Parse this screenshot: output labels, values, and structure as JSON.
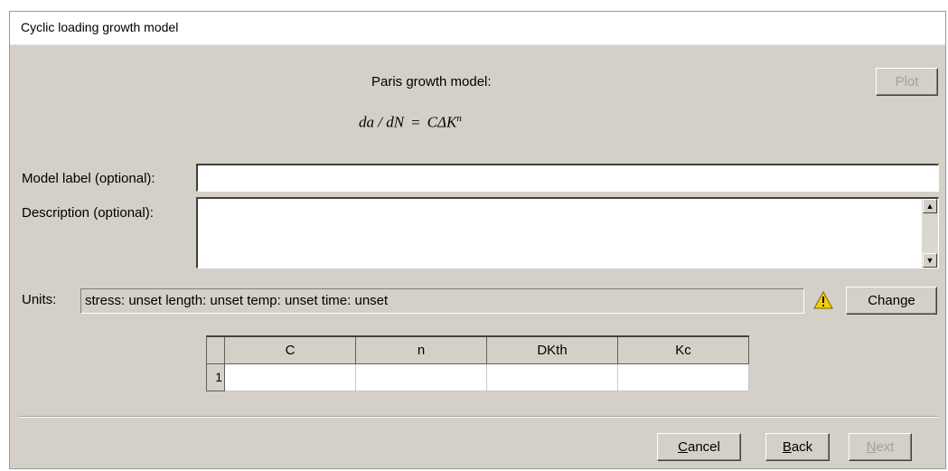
{
  "window": {
    "title": "Cyclic loading growth model"
  },
  "header": {
    "model_caption": "Paris growth model:",
    "formula": {
      "lhs": "da / dN",
      "eq": "=",
      "rhs": "CΔK",
      "exponent": "n"
    },
    "plot_button": "Plot"
  },
  "form": {
    "model_label": {
      "label": "Model label (optional):",
      "value": ""
    },
    "description": {
      "label": "Description (optional):",
      "value": ""
    }
  },
  "units": {
    "label": "Units:",
    "value": "stress: unset   length: unset   temp: unset   time: unset",
    "warning_icon": "warning-triangle-icon",
    "change_button": "Change"
  },
  "table": {
    "columns": [
      "C",
      "n",
      "DKth",
      "Kc"
    ],
    "rows": [
      {
        "index": "1",
        "cells": [
          "",
          "",
          "",
          ""
        ]
      }
    ]
  },
  "footer": {
    "cancel_button": {
      "mnemonic": "C",
      "rest": "ancel"
    },
    "back_button": {
      "mnemonic": "B",
      "rest": "ack"
    },
    "next_button": {
      "mnemonic": "N",
      "rest": "ext"
    }
  },
  "colors": {
    "dialog_bg": "#d4d0c8",
    "title_bg": "#ffffff",
    "disabled_text": "#a0a0a0",
    "warning": "#f5d000"
  }
}
